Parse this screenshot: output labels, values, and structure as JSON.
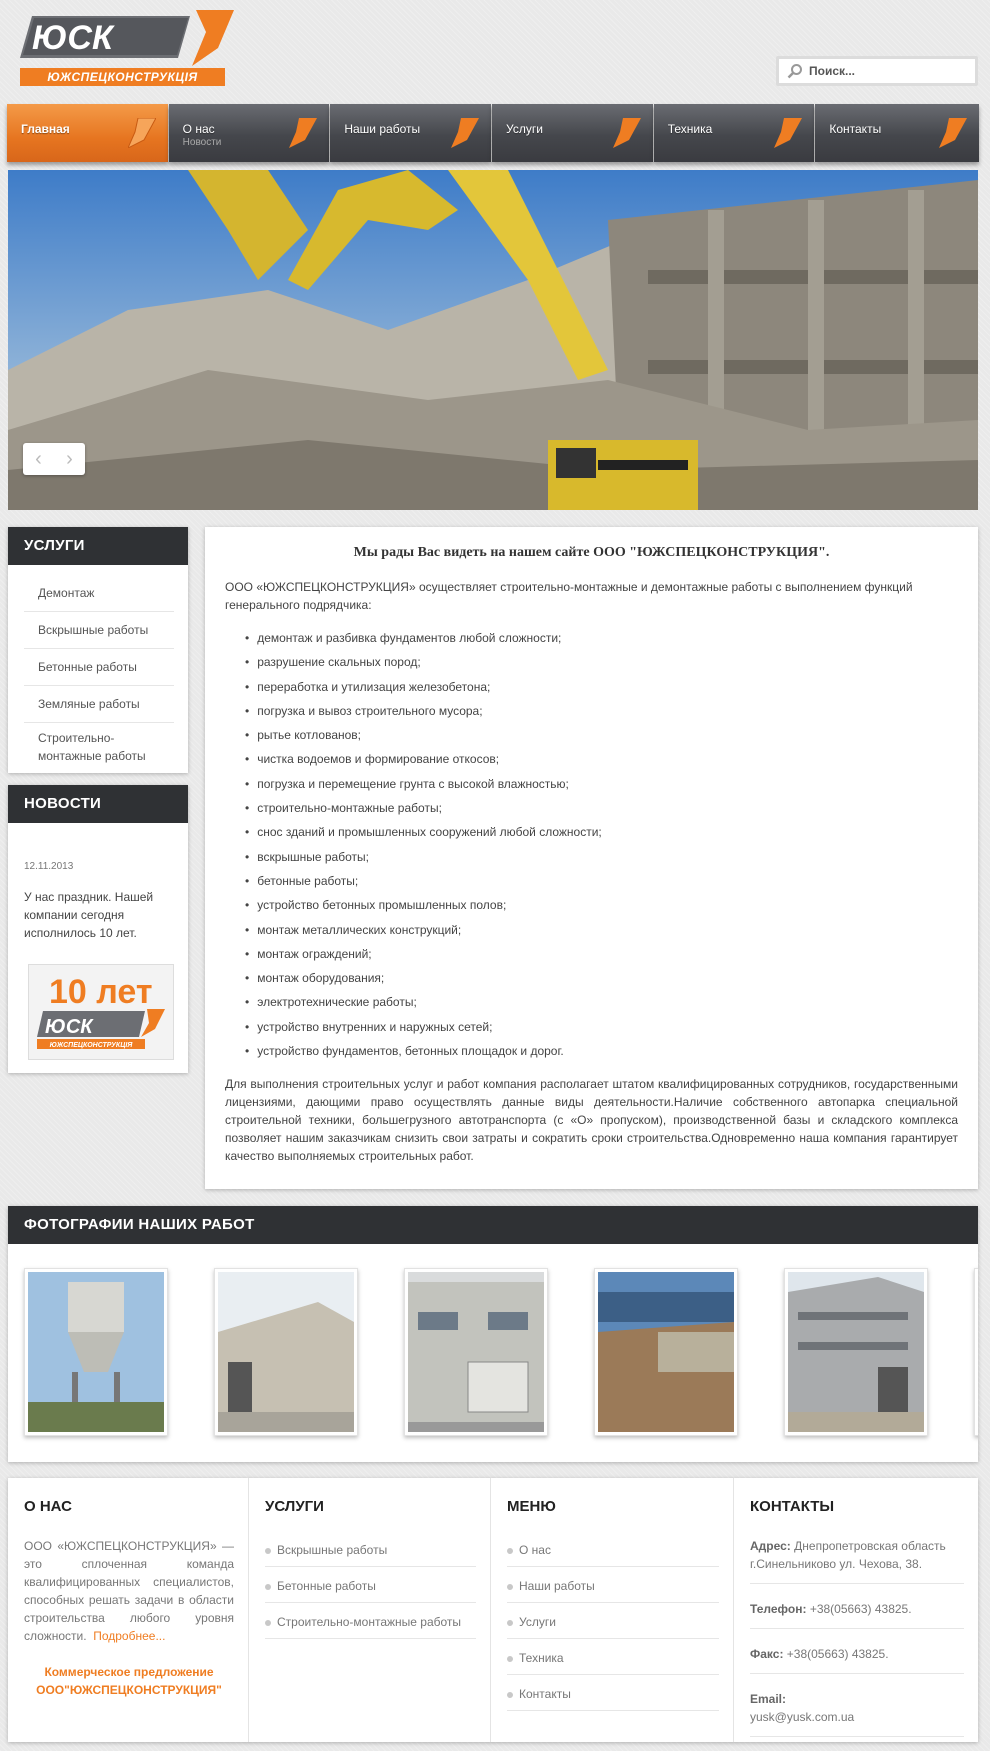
{
  "logo": {
    "brand": "ЮСК",
    "tagline": "ЮЖСПЕЦКОНСТРУКЦІЯ"
  },
  "search": {
    "placeholder": "Поиск..."
  },
  "nav": {
    "items": [
      {
        "label": "Главная",
        "sub": ""
      },
      {
        "label": "О нас",
        "sub": "Новости"
      },
      {
        "label": "Наши работы",
        "sub": ""
      },
      {
        "label": "Услуги",
        "sub": ""
      },
      {
        "label": "Техника",
        "sub": ""
      },
      {
        "label": "Контакты",
        "sub": ""
      }
    ]
  },
  "slider": {
    "prev": "‹",
    "next": "›"
  },
  "services": {
    "title": "УСЛУГИ",
    "items": [
      "Демонтаж",
      "Вскрышные работы",
      "Бетонные работы",
      "Земляные работы",
      "Строительно-монтажные работы"
    ]
  },
  "news": {
    "title": "НОВОСТИ",
    "date": "12.11.2013",
    "text": "У нас праздник. Нашей компании сегодня исполнилось 10 лет.",
    "badge_title": "10 лет",
    "badge_brand": "ЮСК",
    "badge_tagline": "ЮЖСПЕЦКОНСТРУКЦІЯ"
  },
  "main": {
    "heading": "Мы рады Вас видеть на нашем сайте ООО \"ЮЖСПЕЦКОНСТРУКЦИЯ\".",
    "intro": "ООО «ЮЖСПЕЦКОНСТРУКЦИЯ» осуществляет строительно-монтажные и демонтажные работы с выполнением функций генерального подрядчика:",
    "list": [
      "демонтаж и разбивка фундаментов любой сложности;",
      "разрушение скальных пород;",
      "переработка и утилизация железобетона;",
      "погрузка и вывоз строительного мусора;",
      "рытье котлованов;",
      "чистка водоемов и формирование откосов;",
      "погрузка и перемещение грунта с высокой влажностью;",
      "строительно-монтажные работы;",
      "снос зданий и промышленных сооружений любой сложности;",
      "вскрышные работы;",
      "бетонные работы;",
      "устройство бетонных промышленных полов;",
      "монтаж металлических конструкций;",
      "монтаж ограждений;",
      "монтаж оборудования;",
      "электротехнические работы;",
      "устройство внутренних и наружных сетей;",
      "устройство фундаментов, бетонных площадок и дорог."
    ],
    "outro": "Для выполнения строительных услуг и работ компания располагает штатом квалифицированных сотрудников, государственными лицензиями, дающими право осуществлять данные виды деятельности.Наличие собственного автопарка специальной строительной техники, большегрузного автотранспорта (с «О» пропуском), производственной базы и складского комплекса позволяет нашим заказчикам снизить свои затраты и сократить сроки строительства.Одновременно наша компания гарантирует качество выполняемых строительных работ."
  },
  "photos": {
    "title": "ФОТОГРАФИИ НАШИХ РАБОТ"
  },
  "footer": {
    "about": {
      "title": "О НАС",
      "text": "ООО «ЮЖСПЕЦКОНСТРУКЦИЯ» — это сплоченная команда квалифицированных специалистов, способных решать задачи в области строительства любого уровня сложности.",
      "more": "Подробнее...",
      "offer": "Коммерческое предложение ООО\"ЮЖСПЕЦКОНСТРУКЦИЯ\""
    },
    "services": {
      "title": "УСЛУГИ",
      "items": [
        "Вскрышные работы",
        "Бетонные работы",
        "Строительно-монтажные работы"
      ]
    },
    "menu": {
      "title": "МЕНЮ",
      "items": [
        "О нас",
        "Наши работы",
        "Услуги",
        "Техника",
        "Контакты"
      ]
    },
    "contacts": {
      "title": "КОНТАКТЫ",
      "address_label": "Адрес:",
      "address": "Днепропетровская область г.Синельниково ул. Чехова, 38.",
      "phone_label": "Телефон:",
      "phone": "+38(05663) 43825.",
      "fax_label": "Факс:",
      "fax": "+38(05663) 43825.",
      "email_label": "Email:",
      "email": "yusk@yusk.com.ua"
    }
  },
  "colors": {
    "accent": "#ef7d22",
    "dark": "#2f3134",
    "nav": "#45474c"
  }
}
